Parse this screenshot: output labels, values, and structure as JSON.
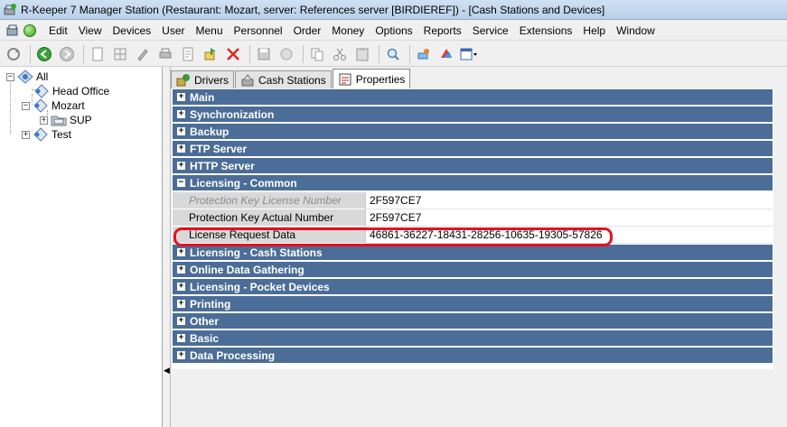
{
  "window": {
    "title": "R-Keeper 7 Manager Station (Restaurant: Mozart, server: References server [BIRDIEREF]) - [Cash Stations and Devices]"
  },
  "menu": [
    {
      "label": "Edit"
    },
    {
      "label": "View"
    },
    {
      "label": "Devices"
    },
    {
      "label": "User"
    },
    {
      "label": "Menu"
    },
    {
      "label": "Personnel"
    },
    {
      "label": "Order"
    },
    {
      "label": "Money"
    },
    {
      "label": "Options"
    },
    {
      "label": "Reports"
    },
    {
      "label": "Service"
    },
    {
      "label": "Extensions"
    },
    {
      "label": "Help"
    },
    {
      "label": "Window"
    }
  ],
  "tree": {
    "all": "All",
    "head_office": "Head Office",
    "mozart": "Mozart",
    "sup": "SUP",
    "test": "Test"
  },
  "tabs": [
    {
      "label": "Drivers"
    },
    {
      "label": "Cash Stations"
    },
    {
      "label": "Properties"
    }
  ],
  "categories_top": [
    {
      "label": "Main"
    },
    {
      "label": "Synchronization"
    },
    {
      "label": "Backup"
    },
    {
      "label": "FTP Server"
    },
    {
      "label": "HTTP Server"
    },
    {
      "label": "Licensing - Common"
    }
  ],
  "properties": [
    {
      "name": "Protection Key License Number",
      "value": "2F597CE7"
    },
    {
      "name": "Protection Key Actual Number",
      "value": "2F597CE7"
    },
    {
      "name": "License Request Data",
      "value": "46861-36227-18431-28256-10635-19305-57826"
    }
  ],
  "categories_bottom": [
    {
      "label": "Licensing - Cash Stations"
    },
    {
      "label": "Online Data Gathering"
    },
    {
      "label": "Licensing - Pocket Devices"
    },
    {
      "label": "Printing"
    },
    {
      "label": "Other"
    },
    {
      "label": "Basic"
    },
    {
      "label": "Data Processing"
    }
  ],
  "symbols": {
    "plus": "+",
    "minus": "−",
    "left_arrow": "◀"
  },
  "colors": {
    "category_bg": "#4b6d97",
    "highlight": "#e8101e"
  }
}
